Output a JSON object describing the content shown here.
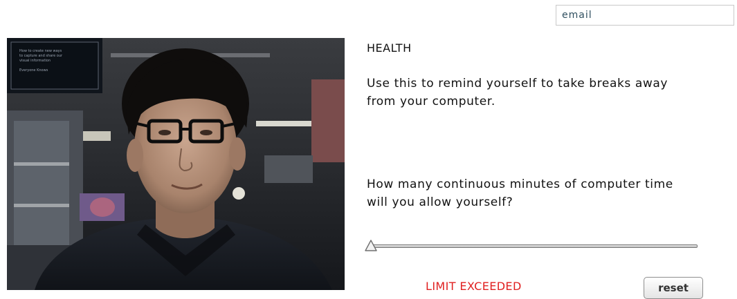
{
  "header": {
    "email_placeholder": "email"
  },
  "health": {
    "title": "HEALTH",
    "description": "Use this to remind yourself to take breaks away from your computer.",
    "question": "How many continuous minutes of computer time will you allow yourself?"
  },
  "slider": {
    "value_fraction": 0.0
  },
  "status": {
    "text": "LIMIT EXCEEDED",
    "color": "#e02020"
  },
  "controls": {
    "reset_label": "reset"
  },
  "webcam": {
    "poster_text": [
      "How to create new ways",
      "to capture and share our",
      "visual information",
      "Everyone Knows"
    ]
  }
}
